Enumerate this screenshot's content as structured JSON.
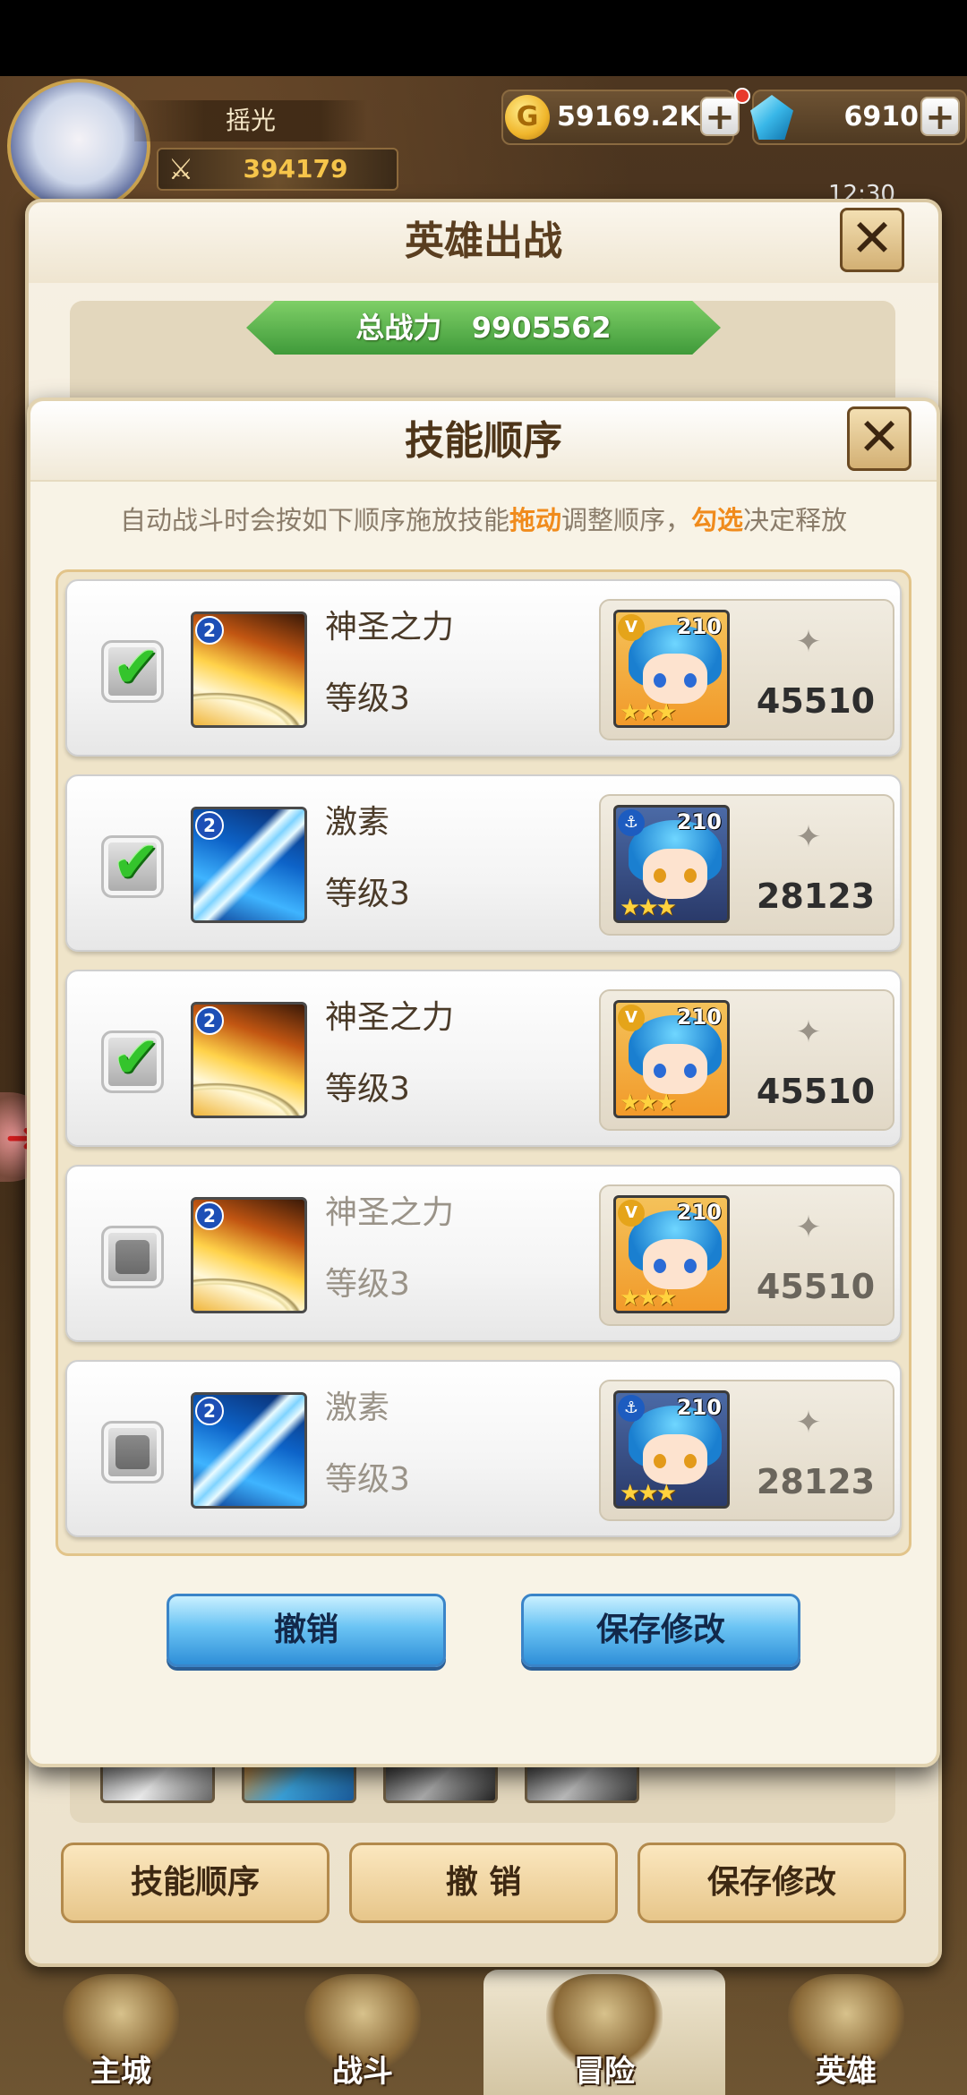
{
  "player": {
    "name": "摇光",
    "power": "394179"
  },
  "currency": {
    "gold": "59169.2K",
    "gems": "6910",
    "plus": "+",
    "gold_symbol": "G"
  },
  "clock": "12:30",
  "deploy_panel": {
    "title": "英雄出战",
    "close": "✕",
    "total_power_label": "总战力",
    "total_power_value": "9905562",
    "buttons": {
      "skill_order": "技能顺序",
      "cancel": "撤 销",
      "save": "保存修改"
    }
  },
  "skill_modal": {
    "title": "技能顺序",
    "close": "✕",
    "instruction_prefix": "自动战斗时会按如下顺序施放技能",
    "instruction_drag": "拖动",
    "instruction_middle": "调整顺序，",
    "instruction_check": "勾选",
    "instruction_suffix": "决定释放",
    "checkmark": "✔",
    "stars": "★★★",
    "power_icon": "✦",
    "rows": [
      {
        "checked": true,
        "skill_name": "神圣之力",
        "skill_level": "等级3",
        "skill_badge": "2",
        "hero_level": "210",
        "hero_class": "V",
        "hero_power": "45510"
      },
      {
        "checked": true,
        "skill_name": "激素",
        "skill_level": "等级3",
        "skill_badge": "2",
        "hero_level": "210",
        "hero_class": "⚓",
        "hero_power": "28123"
      },
      {
        "checked": true,
        "skill_name": "神圣之力",
        "skill_level": "等级3",
        "skill_badge": "2",
        "hero_level": "210",
        "hero_class": "V",
        "hero_power": "45510"
      },
      {
        "checked": false,
        "skill_name": "神圣之力",
        "skill_level": "等级3",
        "skill_badge": "2",
        "hero_level": "210",
        "hero_class": "V",
        "hero_power": "45510"
      },
      {
        "checked": false,
        "skill_name": "激素",
        "skill_level": "等级3",
        "skill_badge": "2",
        "hero_level": "210",
        "hero_class": "⚓",
        "hero_power": "28123"
      }
    ],
    "buttons": {
      "cancel": "撤销",
      "save": "保存修改"
    }
  },
  "bottom_nav": [
    {
      "label": "主城"
    },
    {
      "label": "战斗"
    },
    {
      "label": "冒险"
    },
    {
      "label": "英雄"
    }
  ],
  "colors": {
    "highlight": "#f08b1c",
    "check_green": "#34c42c",
    "button_blue": "#2f8fd8"
  }
}
